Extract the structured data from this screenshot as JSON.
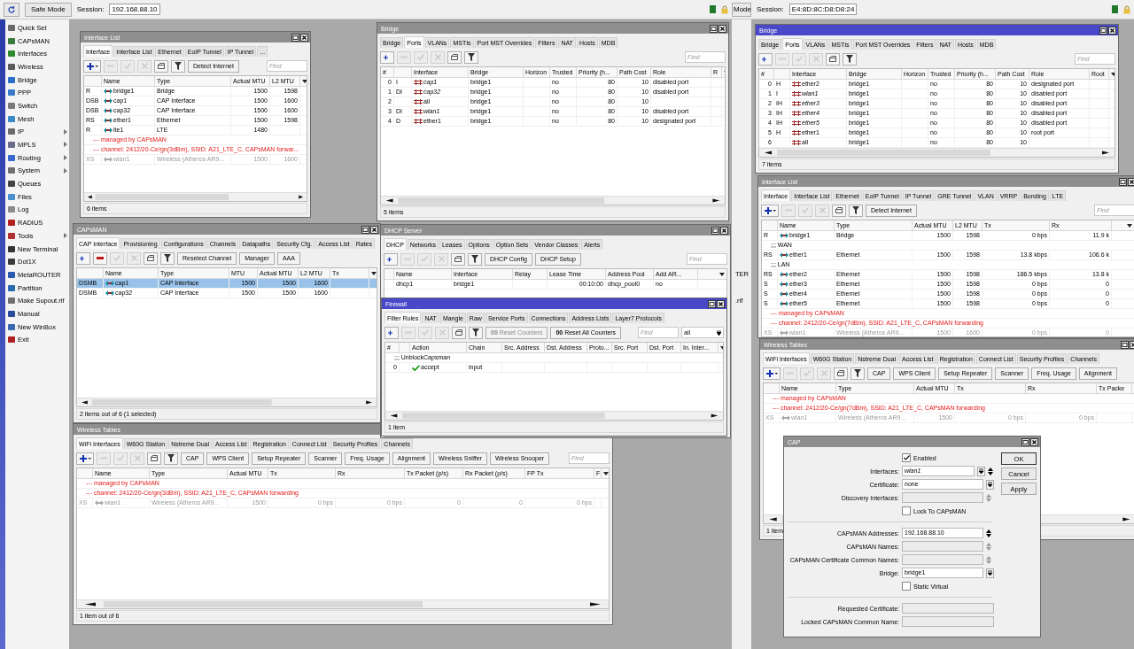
{
  "left_app": {
    "safe_mode": "Safe Mode",
    "session_label": "Session:",
    "session": "192.168.88.10",
    "menu": [
      {
        "label": "Quick Set",
        "submenu": false
      },
      {
        "label": "CAPsMAN",
        "submenu": false
      },
      {
        "label": "Interfaces",
        "submenu": false
      },
      {
        "label": "Wireless",
        "submenu": false
      },
      {
        "label": "Bridge",
        "submenu": false
      },
      {
        "label": "PPP",
        "submenu": false
      },
      {
        "label": "Switch",
        "submenu": false
      },
      {
        "label": "Mesh",
        "submenu": false
      },
      {
        "label": "IP",
        "submenu": true
      },
      {
        "label": "MPLS",
        "submenu": true
      },
      {
        "label": "Routing",
        "submenu": true
      },
      {
        "label": "System",
        "submenu": true
      },
      {
        "label": "Queues",
        "submenu": false
      },
      {
        "label": "Files",
        "submenu": false
      },
      {
        "label": "Log",
        "submenu": false
      },
      {
        "label": "RADIUS",
        "submenu": false
      },
      {
        "label": "Tools",
        "submenu": true
      },
      {
        "label": "New Terminal",
        "submenu": false
      },
      {
        "label": "Dot1X",
        "submenu": false
      },
      {
        "label": "MetaROUTER",
        "submenu": false
      },
      {
        "label": "Partition",
        "submenu": false
      },
      {
        "label": "Make Supout.rif",
        "submenu": false
      },
      {
        "label": "Manual",
        "submenu": false
      },
      {
        "label": "New WinBox",
        "submenu": false
      },
      {
        "label": "Exit",
        "submenu": false
      }
    ]
  },
  "right_app": {
    "safe_mode": "Mode",
    "session_label": "Session:",
    "session": "E4:8D:8C:D8:D8:24",
    "menu": [
      {
        "label": "TER"
      },
      {
        "label": ".rif"
      }
    ]
  },
  "windows": [
    {
      "kind": "table",
      "title": "Interface List",
      "active": false,
      "tabs": [
        {
          "label": "Interface",
          "selected": true
        },
        {
          "label": "Interface List",
          "selected": false
        },
        {
          "label": "Ethernet",
          "selected": false
        },
        {
          "label": "EoIP Tunnel",
          "selected": false
        },
        {
          "label": "IP Tunnel",
          "selected": false
        },
        {
          "label": "...",
          "selected": false
        }
      ],
      "toolbar": [
        {
          "kind": "add-menu",
          "disabled": false
        },
        {
          "kind": "remove",
          "disabled": true
        },
        {
          "kind": "enable",
          "disabled": true
        },
        {
          "kind": "disable",
          "disabled": true
        },
        {
          "kind": "comment",
          "disabled": false
        },
        {
          "kind": "filter",
          "disabled": false
        },
        {
          "kind": "button",
          "label": "Detect Internet",
          "disabled": false
        }
      ],
      "find": {
        "placeholder": "Find"
      },
      "columns": [
        null,
        "Name",
        "Type",
        "Actual MTU",
        "L2 MTU"
      ],
      "rows": [
        {
          "kind": "row",
          "disabled": false,
          "cells": [
            "R",
            "bridge1",
            "Bridge",
            "1500",
            "1598"
          ]
        },
        {
          "kind": "row",
          "disabled": false,
          "cells": [
            "DSB",
            "cap1",
            "CAP Interface",
            "1500",
            "1600"
          ]
        },
        {
          "kind": "row",
          "disabled": false,
          "cells": [
            "DSB",
            "cap32",
            "CAP Interface",
            "1500",
            "1600"
          ]
        },
        {
          "kind": "row",
          "disabled": false,
          "cells": [
            "RS",
            "ether1",
            "Ethernet",
            "1500",
            "1598"
          ]
        },
        {
          "kind": "row",
          "disabled": false,
          "cells": [
            "R",
            "lte1",
            "LTE",
            "1480",
            null
          ]
        },
        {
          "kind": "note",
          "text": "--- managed by CAPsMAN"
        },
        {
          "kind": "note",
          "text": "--- channel: 2412/20-Ce/gn(3dBm), SSID: A21_LTE_C, CAPsMAN forwar..."
        },
        {
          "kind": "row",
          "disabled": true,
          "cells": [
            "XS",
            "wlan1",
            "Wireless (Atheros AR9...",
            "1500",
            "1600"
          ]
        }
      ],
      "status": "6 items"
    },
    {
      "kind": "table",
      "title": "Bridge",
      "active": false,
      "tabs": [
        {
          "label": "Bridge",
          "selected": false
        },
        {
          "label": "Ports",
          "selected": true
        },
        {
          "label": "VLANs",
          "selected": false
        },
        {
          "label": "MSTIs",
          "selected": false
        },
        {
          "label": "Port MST Overrides",
          "selected": false
        },
        {
          "label": "Filters",
          "selected": false
        },
        {
          "label": "NAT",
          "selected": false
        },
        {
          "label": "Hosts",
          "selected": false
        },
        {
          "label": "MDB",
          "selected": false
        }
      ],
      "toolbar": [
        {
          "kind": "add",
          "disabled": false
        },
        {
          "kind": "remove",
          "disabled": true
        },
        {
          "kind": "enable",
          "disabled": true
        },
        {
          "kind": "disable",
          "disabled": true
        },
        {
          "kind": "comment",
          "disabled": false
        },
        {
          "kind": "filter",
          "disabled": false
        }
      ],
      "find": {
        "placeholder": "Find"
      },
      "columns": [
        "#",
        null,
        "Interface",
        "Bridge",
        "Horizon",
        "Trusted",
        "Priority (h...",
        "Path Cost",
        "Role",
        "R"
      ],
      "rows": [
        {
          "kind": "row",
          "inactive": true,
          "cells": [
            "0",
            "I",
            "cap1",
            "bridge1",
            null,
            "no",
            "80",
            "10",
            "disabled port",
            null
          ]
        },
        {
          "kind": "row",
          "inactive": true,
          "cells": [
            "1",
            "DI",
            "cap32",
            "bridge1",
            null,
            "no",
            "80",
            "10",
            "disabled port",
            null
          ]
        },
        {
          "kind": "row",
          "inactive": false,
          "cells": [
            "2",
            null,
            "all",
            "bridge1",
            null,
            "no",
            "80",
            "10",
            null,
            null
          ]
        },
        {
          "kind": "row",
          "inactive": true,
          "cells": [
            "3",
            "DI",
            "wlan1",
            "bridge1",
            null,
            "no",
            "80",
            "10",
            "disabled port",
            null
          ]
        },
        {
          "kind": "row",
          "inactive": false,
          "cells": [
            "4",
            "D",
            "ether1",
            "bridge1",
            null,
            "no",
            "80",
            "10",
            "designated port",
            null
          ]
        }
      ],
      "status": "5 items"
    },
    {
      "kind": "table",
      "title": "CAPsMAN",
      "active": false,
      "tabs": [
        {
          "label": "CAP Interface",
          "selected": true
        },
        {
          "label": "Provisioning",
          "selected": false
        },
        {
          "label": "Configurations",
          "selected": false
        },
        {
          "label": "Channels",
          "selected": false
        },
        {
          "label": "Datapaths",
          "selected": false
        },
        {
          "label": "Security Cfg.",
          "selected": false
        },
        {
          "label": "Access List",
          "selected": false
        },
        {
          "label": "Rates",
          "selected": false
        }
      ],
      "toolbar": [
        {
          "kind": "add",
          "disabled": false
        },
        {
          "kind": "remove",
          "disabled": false
        },
        {
          "kind": "enable",
          "disabled": true
        },
        {
          "kind": "disable",
          "disabled": true
        },
        {
          "kind": "comment",
          "disabled": false
        },
        {
          "kind": "filter",
          "disabled": false
        },
        {
          "kind": "button",
          "label": "Reselect Channel",
          "disabled": false
        },
        {
          "kind": "button",
          "label": "Manager",
          "disabled": false
        },
        {
          "kind": "button",
          "label": "AAA",
          "disabled": false
        }
      ],
      "columns": [
        null,
        "Name",
        "Type",
        "MTU",
        "Actual MTU",
        "L2 MTU",
        "Tx"
      ],
      "rows": [
        {
          "kind": "row",
          "selected": true,
          "cells": [
            "DSMB",
            "cap1",
            "CAP Interface",
            "1500",
            "1500",
            "1600",
            null
          ]
        },
        {
          "kind": "row",
          "selected": false,
          "cells": [
            "DSMB",
            "cap32",
            "CAP Interface",
            "1500",
            "1500",
            "1600",
            null
          ]
        }
      ],
      "status": "2 items out of 6 (1 selected)"
    },
    {
      "kind": "table",
      "title": "Wireless Tables",
      "active": false,
      "tabs": [
        {
          "label": "WiFi Interfaces",
          "selected": true
        },
        {
          "label": "W60G Station",
          "selected": false
        },
        {
          "label": "Nstreme Dual",
          "selected": false
        },
        {
          "label": "Access List",
          "selected": false
        },
        {
          "label": "Registration",
          "selected": false
        },
        {
          "label": "Connect List",
          "selected": false
        },
        {
          "label": "Security Profiles",
          "selected": false
        },
        {
          "label": "Channels",
          "selected": false
        }
      ],
      "toolbar": [
        {
          "kind": "add-menu",
          "disabled": false
        },
        {
          "kind": "remove",
          "disabled": true
        },
        {
          "kind": "enable",
          "disabled": true
        },
        {
          "kind": "disable",
          "disabled": true
        },
        {
          "kind": "comment",
          "disabled": false
        },
        {
          "kind": "filter",
          "disabled": false
        },
        {
          "kind": "button",
          "label": "CAP",
          "disabled": false
        },
        {
          "kind": "button",
          "label": "WPS Client",
          "disabled": false
        },
        {
          "kind": "button",
          "label": "Setup Repeater",
          "disabled": false
        },
        {
          "kind": "button",
          "label": "Scanner",
          "disabled": false
        },
        {
          "kind": "button",
          "label": "Freq. Usage",
          "disabled": false
        },
        {
          "kind": "button",
          "label": "Alignment",
          "disabled": false
        },
        {
          "kind": "button",
          "label": "Wireless Sniffer",
          "disabled": false
        },
        {
          "kind": "button",
          "label": "Wireless Snooper",
          "disabled": false
        }
      ],
      "find": {
        "placeholder": "Find"
      },
      "columns": [
        null,
        "Name",
        "Type",
        "Actual MTU",
        "Tx",
        "Rx",
        "Tx Packet (p/s)",
        "Rx Packet (p/s)",
        "FP Tx",
        "F"
      ],
      "rows": [
        {
          "kind": "note",
          "text": "--- managed by CAPsMAN"
        },
        {
          "kind": "note",
          "text": "--- channel: 2412/20-Ce/gn(3dBm), SSID: A21_LTE_C, CAPsMAN forwarding"
        },
        {
          "kind": "row",
          "disabled": true,
          "cells": [
            "XS",
            "wlan1",
            "Wireless (Atheros AR9...",
            "1500",
            "0 bps",
            "0 bps",
            "0",
            "0",
            "0 bps",
            null
          ]
        }
      ],
      "status": "1 item out of 6"
    },
    {
      "kind": "table",
      "title": "DHCP Server",
      "active": false,
      "tabs": [
        {
          "label": "DHCP",
          "selected": true
        },
        {
          "label": "Networks",
          "selected": false
        },
        {
          "label": "Leases",
          "selected": false
        },
        {
          "label": "Options",
          "selected": false
        },
        {
          "label": "Option Sets",
          "selected": false
        },
        {
          "label": "Vendor Classes",
          "selected": false
        },
        {
          "label": "Alerts",
          "selected": false
        }
      ],
      "toolbar": [
        {
          "kind": "add",
          "disabled": false
        },
        {
          "kind": "remove",
          "disabled": true
        },
        {
          "kind": "enable",
          "disabled": true
        },
        {
          "kind": "disable",
          "disabled": true
        },
        {
          "kind": "comment",
          "disabled": false
        },
        {
          "kind": "filter",
          "disabled": false
        },
        {
          "kind": "button",
          "label": "DHCP Config",
          "disabled": false
        },
        {
          "kind": "button",
          "label": "DHCP Setup",
          "disabled": false
        }
      ],
      "find": {
        "placeholder": "Find"
      },
      "columns": [
        null,
        "Name",
        "Interface",
        "Relay",
        "Lease Time",
        "Address Pool",
        "Add AR..."
      ],
      "rows": [
        {
          "kind": "row",
          "cells": [
            null,
            "dhcp1",
            "bridge1",
            null,
            "00:10:00",
            "dhcp_pool0",
            "no"
          ]
        }
      ]
    },
    {
      "kind": "table",
      "title": "Firewall",
      "active": true,
      "tabs": [
        {
          "label": "Filter Rules",
          "selected": true
        },
        {
          "label": "NAT",
          "selected": false
        },
        {
          "label": "Mangle",
          "selected": false
        },
        {
          "label": "Raw",
          "selected": false
        },
        {
          "label": "Service Ports",
          "selected": false
        },
        {
          "label": "Connections",
          "selected": false
        },
        {
          "label": "Address Lists",
          "selected": false
        },
        {
          "label": "Layer7 Protocols",
          "selected": false
        }
      ],
      "toolbar": [
        {
          "kind": "add",
          "disabled": false
        },
        {
          "kind": "remove",
          "disabled": true
        },
        {
          "kind": "enable",
          "disabled": true
        },
        {
          "kind": "disable",
          "disabled": true
        },
        {
          "kind": "comment",
          "disabled": false
        },
        {
          "kind": "filter",
          "disabled": false
        },
        {
          "kind": "counter-button",
          "prefix": "00",
          "label": "Reset Counters",
          "disabled": true
        },
        {
          "kind": "counter-button",
          "prefix": "00",
          "label": "Reset All Counters",
          "disabled": false
        }
      ],
      "find": {
        "placeholder": "Find"
      },
      "scope": "all",
      "columns": [
        "#",
        null,
        "Action",
        "Chain",
        "Src. Address",
        "Dst. Address",
        "Proto...",
        "Src. Port",
        "Dst. Port",
        "In. Inter..."
      ],
      "rows": [
        {
          "kind": "comment",
          "text": ";;; UnblockCapsman"
        },
        {
          "kind": "row",
          "cells": [
            "0",
            null,
            "accept",
            "input",
            null,
            null,
            null,
            null,
            null,
            null
          ]
        }
      ],
      "status": "1 item"
    },
    {
      "kind": "table",
      "title": "Bridge",
      "active": true,
      "tabs": [
        {
          "label": "Bridge",
          "selected": false
        },
        {
          "label": "Ports",
          "selected": true
        },
        {
          "label": "VLANs",
          "selected": false
        },
        {
          "label": "MSTIs",
          "selected": false
        },
        {
          "label": "Port MST Overrides",
          "selected": false
        },
        {
          "label": "Filters",
          "selected": false
        },
        {
          "label": "NAT",
          "selected": false
        },
        {
          "label": "Hosts",
          "selected": false
        },
        {
          "label": "MDB",
          "selected": false
        }
      ],
      "toolbar": [
        {
          "kind": "add",
          "disabled": false
        },
        {
          "kind": "remove",
          "disabled": true
        },
        {
          "kind": "enable",
          "disabled": true
        },
        {
          "kind": "disable",
          "disabled": true
        },
        {
          "kind": "comment",
          "disabled": false
        },
        {
          "kind": "filter",
          "disabled": false
        }
      ],
      "find": {
        "placeholder": "Find"
      },
      "columns": [
        "#",
        null,
        "Interface",
        "Bridge",
        "Horizon",
        "Trusted",
        "Priority (h...",
        "Path Cost",
        "Role",
        "Root"
      ],
      "rows": [
        {
          "kind": "row",
          "inactive": false,
          "cells": [
            "0",
            "H",
            "ether2",
            "bridge1",
            null,
            "no",
            "80",
            "10",
            "designated port",
            null
          ]
        },
        {
          "kind": "row",
          "inactive": true,
          "cells": [
            "1",
            "I",
            "wlan1",
            "bridge1",
            null,
            "no",
            "80",
            "10",
            "disabled port",
            null
          ]
        },
        {
          "kind": "row",
          "inactive": true,
          "cells": [
            "2",
            "IH",
            "ether3",
            "bridge1",
            null,
            "no",
            "80",
            "10",
            "disabled port",
            null
          ]
        },
        {
          "kind": "row",
          "inactive": true,
          "cells": [
            "3",
            "IH",
            "ether4",
            "bridge1",
            null,
            "no",
            "80",
            "10",
            "disabled port",
            null
          ]
        },
        {
          "kind": "row",
          "inactive": true,
          "cells": [
            "4",
            "IH",
            "ether5",
            "bridge1",
            null,
            "no",
            "80",
            "10",
            "disabled port",
            null
          ]
        },
        {
          "kind": "row",
          "inactive": false,
          "cells": [
            "5",
            "H",
            "ether1",
            "bridge1",
            null,
            "no",
            "80",
            "10",
            "root port",
            null
          ]
        },
        {
          "kind": "row",
          "inactive": false,
          "cells": [
            "6",
            null,
            "all",
            "bridge1",
            null,
            "no",
            "80",
            "10",
            null,
            null
          ]
        }
      ],
      "status": "7 items"
    },
    {
      "kind": "table",
      "title": "Interface List",
      "active": false,
      "tabs": [
        {
          "label": "Interface",
          "selected": true
        },
        {
          "label": "Interface List",
          "selected": false
        },
        {
          "label": "Ethernet",
          "selected": false
        },
        {
          "label": "EoIP Tunnel",
          "selected": false
        },
        {
          "label": "IP Tunnel",
          "selected": false
        },
        {
          "label": "GRE Tunnel",
          "selected": false
        },
        {
          "label": "VLAN",
          "selected": false
        },
        {
          "label": "VRRP",
          "selected": false
        },
        {
          "label": "Bonding",
          "selected": false
        },
        {
          "label": "LTE",
          "selected": false
        }
      ],
      "toolbar": [
        {
          "kind": "add-menu",
          "disabled": false
        },
        {
          "kind": "remove",
          "disabled": true
        },
        {
          "kind": "enable",
          "disabled": true
        },
        {
          "kind": "disable",
          "disabled": true
        },
        {
          "kind": "comment",
          "disabled": false
        },
        {
          "kind": "filter",
          "disabled": false
        },
        {
          "kind": "button",
          "label": "Detect Internet",
          "disabled": false
        }
      ],
      "find": {
        "placeholder": "Find"
      },
      "columns": [
        null,
        "Name",
        "Type",
        "Actual MTU",
        "L2 MTU",
        "Tx",
        "Rx"
      ],
      "rows": [
        {
          "kind": "row",
          "disabled": false,
          "cells": [
            "R",
            "bridge1",
            "Bridge",
            "1500",
            "1598",
            "0 bps",
            "11.9 k"
          ]
        },
        {
          "kind": "comment",
          "text": ";;; WAN"
        },
        {
          "kind": "row",
          "disabled": false,
          "cells": [
            "RS",
            "ether1",
            "Ethernet",
            "1500",
            "1598",
            "13.8 kbps",
            "106.6 k"
          ]
        },
        {
          "kind": "comment",
          "text": ";;; LAN"
        },
        {
          "kind": "row",
          "disabled": false,
          "cells": [
            "RS",
            "ether2",
            "Ethernet",
            "1500",
            "1598",
            "186.5 kbps",
            "13.8 k"
          ]
        },
        {
          "kind": "row",
          "disabled": false,
          "cells": [
            "S",
            "ether3",
            "Ethernet",
            "1500",
            "1598",
            "0 bps",
            "0"
          ]
        },
        {
          "kind": "row",
          "disabled": false,
          "cells": [
            "S",
            "ether4",
            "Ethernet",
            "1500",
            "1598",
            "0 bps",
            "0"
          ]
        },
        {
          "kind": "row",
          "disabled": false,
          "cells": [
            "S",
            "ether5",
            "Ethernet",
            "1500",
            "1598",
            "0 bps",
            "0"
          ]
        },
        {
          "kind": "note",
          "text": "--- managed by CAPsMAN"
        },
        {
          "kind": "note",
          "text": "--- channel: 2412/20-Ce/gn(7dBm), SSID: A21_LTE_C, CAPsMAN forwarding"
        },
        {
          "kind": "row",
          "disabled": true,
          "cells": [
            "XS",
            "wlan1",
            "Wireless (Atheros AR9...",
            "1500",
            "1600",
            "0 bps",
            "0"
          ]
        }
      ]
    },
    {
      "kind": "table",
      "title": "Wireless Tables",
      "active": false,
      "tabs": [
        {
          "label": "WiFi Interfaces",
          "selected": true
        },
        {
          "label": "W60G Station",
          "selected": false
        },
        {
          "label": "Nstreme Dual",
          "selected": false
        },
        {
          "label": "Access List",
          "selected": false
        },
        {
          "label": "Registration",
          "selected": false
        },
        {
          "label": "Connect List",
          "selected": false
        },
        {
          "label": "Security Profiles",
          "selected": false
        },
        {
          "label": "Channels",
          "selected": false
        }
      ],
      "toolbar": [
        {
          "kind": "add-menu",
          "disabled": false
        },
        {
          "kind": "remove",
          "disabled": true
        },
        {
          "kind": "enable",
          "disabled": true
        },
        {
          "kind": "disable",
          "disabled": true
        },
        {
          "kind": "comment",
          "disabled": false
        },
        {
          "kind": "filter",
          "disabled": false
        },
        {
          "kind": "button",
          "label": "CAP",
          "disabled": false
        },
        {
          "kind": "button",
          "label": "WPS Client",
          "disabled": false
        },
        {
          "kind": "button",
          "label": "Setup Repeater",
          "disabled": false
        },
        {
          "kind": "button",
          "label": "Scanner",
          "disabled": false
        },
        {
          "kind": "button",
          "label": "Freq. Usage",
          "disabled": false
        },
        {
          "kind": "button",
          "label": "Alignment",
          "disabled": false
        }
      ],
      "columns": [
        null,
        "Name",
        "Type",
        "Actual MTU",
        "Tx",
        "Rx",
        "Tx Packe"
      ],
      "rows": [
        {
          "kind": "note",
          "text": "--- managed by CAPsMAN"
        },
        {
          "kind": "note",
          "text": "--- channel: 2412/20-Ce/gn(7dBm), SSID: A21_LTE_C, CAPsMAN forwarding"
        },
        {
          "kind": "row",
          "disabled": true,
          "cells": [
            "XS",
            "wlan1",
            "Wireless (Atheros AR9...",
            "1500",
            "0 bps",
            "0 bps",
            null
          ]
        }
      ],
      "status": "1 item"
    },
    {
      "kind": "form",
      "title": "CAP",
      "active": false,
      "fields": [
        {
          "kind": "checkbox",
          "label": "Enabled",
          "checked": true
        },
        {
          "kind": "select-list",
          "label": "Interfaces:",
          "value": "wlan1",
          "disabled": false
        },
        {
          "kind": "select",
          "label": "Certificate:",
          "value": "none",
          "disabled": false
        },
        {
          "kind": "list",
          "label": "Discovery Interfaces:",
          "disabled": true
        },
        {
          "kind": "checkbox",
          "label": "Lock To CAPsMAN",
          "checked": false
        },
        {
          "kind": "divider"
        },
        {
          "kind": "list",
          "label": "CAPsMAN Addresses:",
          "value": "192.168.88.10",
          "disabled": false
        },
        {
          "kind": "list",
          "label": "CAPsMAN Names:",
          "disabled": true
        },
        {
          "kind": "list",
          "label": "CAPsMAN Certificate Common Names:",
          "disabled": true
        },
        {
          "kind": "select",
          "label": "Bridge:",
          "value": "bridge1",
          "disabled": false
        },
        {
          "kind": "checkbox",
          "label": "Static Virtual",
          "checked": false
        },
        {
          "kind": "divider"
        },
        {
          "kind": "text",
          "label": "Requested Certificate:",
          "disabled": true
        },
        {
          "kind": "text",
          "label": "Locked CAPsMAN Common Name:",
          "disabled": true
        }
      ],
      "buttons": [
        {
          "label": "OK",
          "default": true
        },
        {
          "label": "Cancel",
          "default": false
        },
        {
          "label": "Apply",
          "default": false
        }
      ]
    }
  ]
}
